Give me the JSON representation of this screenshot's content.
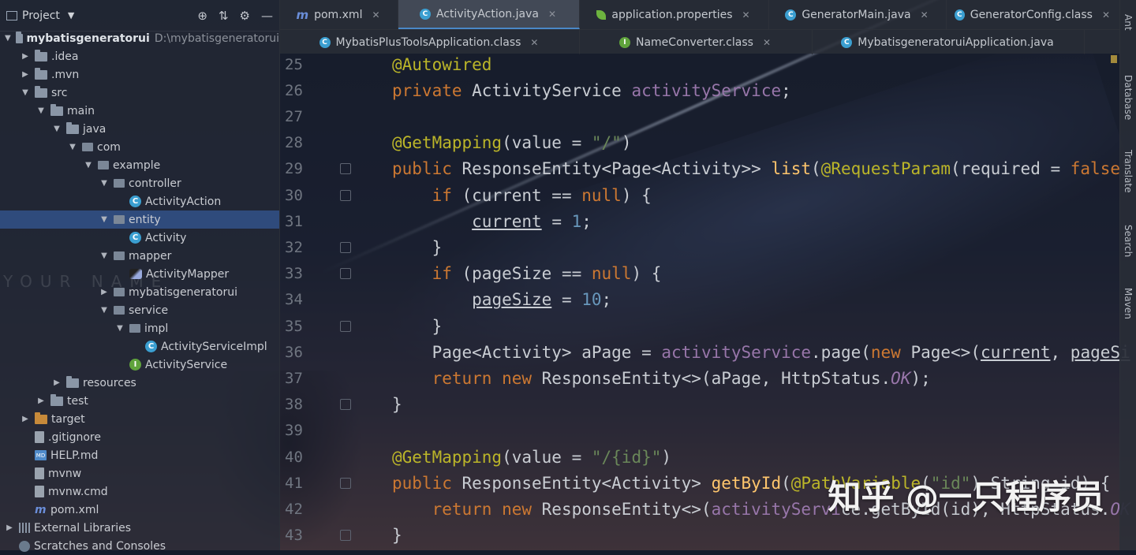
{
  "project_panel": {
    "title": "Project",
    "tree": [
      {
        "label": "mybatisgeneratorui",
        "hint": "D:\\mybatisgeneratorui",
        "depth": 0,
        "expanded": true,
        "icon": "module-folder-icon",
        "bold": true
      },
      {
        "label": ".idea",
        "depth": 1,
        "expanded": false,
        "icon": "folder-icon"
      },
      {
        "label": ".mvn",
        "depth": 1,
        "expanded": false,
        "icon": "folder-icon"
      },
      {
        "label": "src",
        "depth": 1,
        "expanded": true,
        "icon": "folder-icon"
      },
      {
        "label": "main",
        "depth": 2,
        "expanded": true,
        "icon": "folder-icon"
      },
      {
        "label": "java",
        "depth": 3,
        "expanded": true,
        "icon": "source-folder-icon"
      },
      {
        "label": "com",
        "depth": 4,
        "expanded": true,
        "icon": "package-icon"
      },
      {
        "label": "example",
        "depth": 5,
        "expanded": true,
        "icon": "package-icon"
      },
      {
        "label": "controller",
        "depth": 6,
        "expanded": true,
        "icon": "package-icon"
      },
      {
        "label": "ActivityAction",
        "depth": 7,
        "icon": "class-icon"
      },
      {
        "label": "entity",
        "depth": 6,
        "expanded": true,
        "icon": "package-icon",
        "selected": true
      },
      {
        "label": "Activity",
        "depth": 7,
        "icon": "class-icon"
      },
      {
        "label": "mapper",
        "depth": 6,
        "expanded": true,
        "icon": "package-icon"
      },
      {
        "label": "ActivityMapper",
        "depth": 7,
        "icon": "mybatis-icon"
      },
      {
        "label": "mybatisgeneratorui",
        "depth": 6,
        "expanded": false,
        "icon": "package-icon"
      },
      {
        "label": "service",
        "depth": 6,
        "expanded": true,
        "icon": "package-icon"
      },
      {
        "label": "impl",
        "depth": 7,
        "expanded": true,
        "icon": "package-icon"
      },
      {
        "label": "ActivityServiceImpl",
        "depth": 8,
        "icon": "class-icon"
      },
      {
        "label": "ActivityService",
        "depth": 7,
        "icon": "interface-icon"
      },
      {
        "label": "resources",
        "depth": 3,
        "expanded": false,
        "icon": "resources-folder-icon"
      },
      {
        "label": "test",
        "depth": 2,
        "expanded": false,
        "icon": "folder-icon"
      },
      {
        "label": "target",
        "depth": 1,
        "expanded": false,
        "icon": "excluded-folder-icon"
      },
      {
        "label": ".gitignore",
        "depth": 1,
        "icon": "file-icon"
      },
      {
        "label": "HELP.md",
        "depth": 1,
        "icon": "markdown-icon"
      },
      {
        "label": "mvnw",
        "depth": 1,
        "icon": "file-icon"
      },
      {
        "label": "mvnw.cmd",
        "depth": 1,
        "icon": "file-icon"
      },
      {
        "label": "pom.xml",
        "depth": 1,
        "icon": "maven-icon"
      },
      {
        "label": "External Libraries",
        "depth": 0,
        "expanded": false,
        "icon": "libraries-icon"
      },
      {
        "label": "Scratches and Consoles",
        "depth": 0,
        "icon": "scratches-icon"
      }
    ]
  },
  "tabs": {
    "row1": [
      {
        "label": "pom.xml",
        "icon": "maven-icon",
        "closable": true
      },
      {
        "label": "ActivityAction.java",
        "icon": "class-icon",
        "closable": true,
        "active": true
      },
      {
        "label": "application.properties",
        "icon": "spring-leaf-icon",
        "closable": true
      },
      {
        "label": "GeneratorMain.java",
        "icon": "class-icon",
        "closable": true
      },
      {
        "label": "GeneratorConfig.class",
        "icon": "class-icon",
        "closable": true
      }
    ],
    "row2": [
      {
        "label": "MybatisPlusToolsApplication.class",
        "icon": "class-icon",
        "closable": true
      },
      {
        "label": "NameConverter.class",
        "icon": "interface-icon",
        "closable": true
      },
      {
        "label": "MybatisgeneratoruiApplication.java",
        "icon": "class-icon",
        "closable": false
      }
    ]
  },
  "editor": {
    "lines": [
      {
        "num": "25",
        "fold": false,
        "html": "<span class='ann'>@Autowired</span>"
      },
      {
        "num": "26",
        "fold": false,
        "html": "<span class='kw'>private</span> ActivityService <span class='fld'>activityService</span>;"
      },
      {
        "num": "27",
        "fold": false,
        "html": ""
      },
      {
        "num": "28",
        "fold": false,
        "html": "<span class='ann'>@GetMapping</span>(value = <span class='str'>\"/\"</span>)"
      },
      {
        "num": "29",
        "fold": true,
        "html": "<span class='kw'>public</span> ResponseEntity&lt;Page&lt;Activity&gt;&gt; <span class='fn'>list</span>(<span class='ann'>@RequestParam</span>(required = <span class='kw'>false</span>)"
      },
      {
        "num": "30",
        "fold": true,
        "html": "    <span class='kw'>if</span> (current == <span class='kw'>null</span>) {"
      },
      {
        "num": "31",
        "fold": false,
        "html": "        <span class='und'>current</span> = <span class='num'>1</span>;"
      },
      {
        "num": "32",
        "fold": true,
        "html": "    }"
      },
      {
        "num": "33",
        "fold": true,
        "html": "    <span class='kw'>if</span> (pageSize == <span class='kw'>null</span>) {"
      },
      {
        "num": "34",
        "fold": false,
        "html": "        <span class='und'>pageSize</span> = <span class='num'>10</span>;"
      },
      {
        "num": "35",
        "fold": true,
        "html": "    }"
      },
      {
        "num": "36",
        "fold": false,
        "html": "    Page&lt;Activity&gt; aPage = <span class='fld'>activityService</span>.page(<span class='kw'>new</span> Page&lt;&gt;(<span class='und'>current</span>, <span class='und'>pageSi</span>"
      },
      {
        "num": "37",
        "fold": false,
        "html": "    <span class='kw'>return new</span> ResponseEntity&lt;&gt;(aPage, HttpStatus.<span class='fld ital'>OK</span>);"
      },
      {
        "num": "38",
        "fold": true,
        "html": "}"
      },
      {
        "num": "39",
        "fold": false,
        "html": ""
      },
      {
        "num": "40",
        "fold": false,
        "html": "<span class='ann'>@GetMapping</span>(value = <span class='str'>\"/{id}\"</span>)"
      },
      {
        "num": "41",
        "fold": true,
        "html": "<span class='kw'>public</span> ResponseEntity&lt;Activity&gt; <span class='fn'>getById</span>(<span class='ann'>@PathVariable</span>(<span class='str'>\"id\"</span>) String id) {"
      },
      {
        "num": "42",
        "fold": false,
        "html": "    <span class='kw'>return new</span> ResponseEntity&lt;&gt;(<span class='fld'>activityServi</span>ce.getById(id), HttpStatus.<span class='fld ital'>OK</span>"
      },
      {
        "num": "43",
        "fold": true,
        "html": "}"
      }
    ]
  },
  "right_tools": [
    "Ant",
    "Database",
    "Translate",
    "Search",
    "Maven"
  ],
  "watermark": "知乎 @一只程序员",
  "bg_text": "YOUR NAME"
}
